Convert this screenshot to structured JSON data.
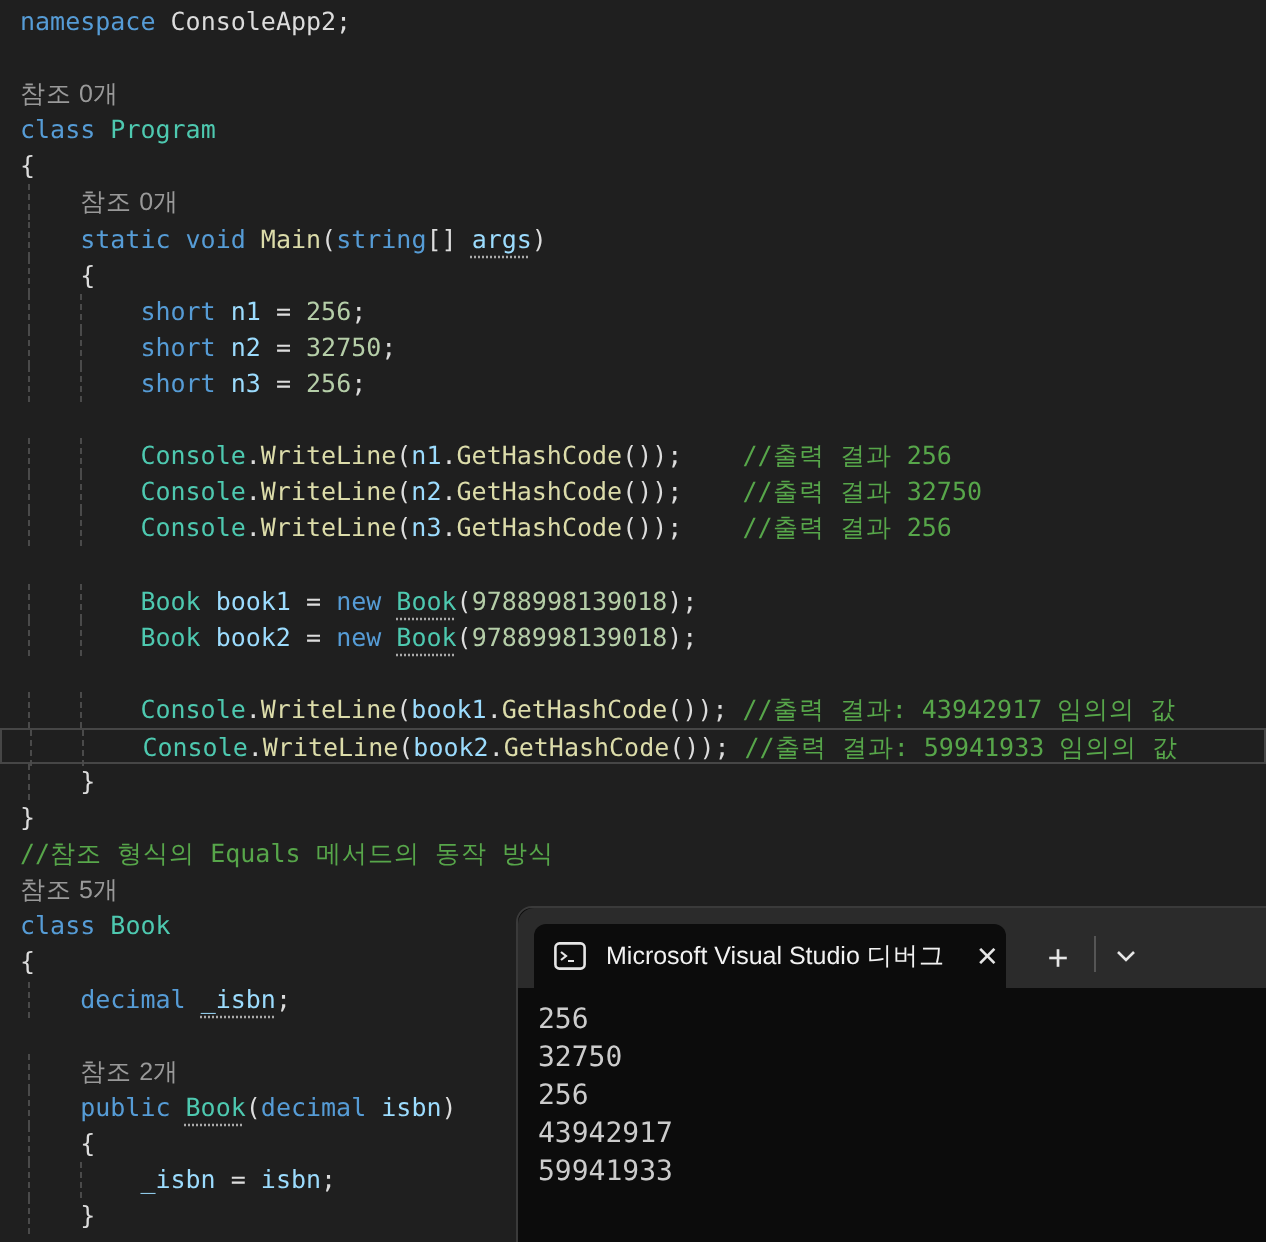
{
  "editor": {
    "lines": [
      {
        "kind": "code",
        "tokens": [
          {
            "kind": "keyword",
            "text": "namespace "
          },
          {
            "kind": "plain",
            "text": "ConsoleApp2;"
          }
        ]
      },
      {
        "kind": "blank"
      },
      {
        "kind": "lens",
        "tokens": [
          {
            "kind": "lens",
            "text": "참조 0개"
          }
        ]
      },
      {
        "kind": "code",
        "tokens": [
          {
            "kind": "keyword",
            "text": "class "
          },
          {
            "kind": "type",
            "text": "Program"
          }
        ]
      },
      {
        "kind": "code",
        "tokens": [
          {
            "kind": "plain",
            "text": "{"
          }
        ]
      },
      {
        "kind": "lens",
        "tokens": [
          {
            "kind": "lens",
            "text": "    참조 0개"
          }
        ]
      },
      {
        "kind": "code",
        "tokens": [
          {
            "kind": "keyword",
            "text": "    static void "
          },
          {
            "kind": "method",
            "text": "Main"
          },
          {
            "kind": "plain",
            "text": "("
          },
          {
            "kind": "keyword",
            "text": "string"
          },
          {
            "kind": "plain",
            "text": "[] "
          },
          {
            "kind": "variable",
            "text": "args",
            "hint": true
          },
          {
            "kind": "plain",
            "text": ")"
          }
        ]
      },
      {
        "kind": "code",
        "tokens": [
          {
            "kind": "plain",
            "text": "    {"
          }
        ]
      },
      {
        "kind": "code",
        "tokens": [
          {
            "kind": "keyword",
            "text": "        short "
          },
          {
            "kind": "variable",
            "text": "n1"
          },
          {
            "kind": "plain",
            "text": " = "
          },
          {
            "kind": "number",
            "text": "256"
          },
          {
            "kind": "plain",
            "text": ";"
          }
        ]
      },
      {
        "kind": "code",
        "tokens": [
          {
            "kind": "keyword",
            "text": "        short "
          },
          {
            "kind": "variable",
            "text": "n2"
          },
          {
            "kind": "plain",
            "text": " = "
          },
          {
            "kind": "number",
            "text": "32750"
          },
          {
            "kind": "plain",
            "text": ";"
          }
        ]
      },
      {
        "kind": "code",
        "tokens": [
          {
            "kind": "keyword",
            "text": "        short "
          },
          {
            "kind": "variable",
            "text": "n3"
          },
          {
            "kind": "plain",
            "text": " = "
          },
          {
            "kind": "number",
            "text": "256"
          },
          {
            "kind": "plain",
            "text": ";"
          }
        ]
      },
      {
        "kind": "blank"
      },
      {
        "kind": "code",
        "tokens": [
          {
            "kind": "type",
            "text": "        Console"
          },
          {
            "kind": "plain",
            "text": "."
          },
          {
            "kind": "method",
            "text": "WriteLine"
          },
          {
            "kind": "plain",
            "text": "("
          },
          {
            "kind": "variable",
            "text": "n1"
          },
          {
            "kind": "plain",
            "text": "."
          },
          {
            "kind": "method",
            "text": "GetHashCode"
          },
          {
            "kind": "plain",
            "text": "());    "
          },
          {
            "kind": "comment",
            "text": "//출력 결과 256"
          }
        ]
      },
      {
        "kind": "code",
        "tokens": [
          {
            "kind": "type",
            "text": "        Console"
          },
          {
            "kind": "plain",
            "text": "."
          },
          {
            "kind": "method",
            "text": "WriteLine"
          },
          {
            "kind": "plain",
            "text": "("
          },
          {
            "kind": "variable",
            "text": "n2"
          },
          {
            "kind": "plain",
            "text": "."
          },
          {
            "kind": "method",
            "text": "GetHashCode"
          },
          {
            "kind": "plain",
            "text": "());    "
          },
          {
            "kind": "comment",
            "text": "//출력 결과 32750"
          }
        ]
      },
      {
        "kind": "code",
        "tokens": [
          {
            "kind": "type",
            "text": "        Console"
          },
          {
            "kind": "plain",
            "text": "."
          },
          {
            "kind": "method",
            "text": "WriteLine"
          },
          {
            "kind": "plain",
            "text": "("
          },
          {
            "kind": "variable",
            "text": "n3"
          },
          {
            "kind": "plain",
            "text": "."
          },
          {
            "kind": "method",
            "text": "GetHashCode"
          },
          {
            "kind": "plain",
            "text": "());    "
          },
          {
            "kind": "comment",
            "text": "//출력 결과 256"
          }
        ]
      },
      {
        "kind": "blank"
      },
      {
        "kind": "code",
        "tokens": [
          {
            "kind": "type",
            "text": "        Book "
          },
          {
            "kind": "variable",
            "text": "book1"
          },
          {
            "kind": "plain",
            "text": " = "
          },
          {
            "kind": "keyword",
            "text": "new "
          },
          {
            "kind": "type",
            "text": "Book",
            "hint": true
          },
          {
            "kind": "plain",
            "text": "("
          },
          {
            "kind": "number",
            "text": "9788998139018"
          },
          {
            "kind": "plain",
            "text": ");"
          }
        ]
      },
      {
        "kind": "code",
        "tokens": [
          {
            "kind": "type",
            "text": "        Book "
          },
          {
            "kind": "variable",
            "text": "book2"
          },
          {
            "kind": "plain",
            "text": " = "
          },
          {
            "kind": "keyword",
            "text": "new "
          },
          {
            "kind": "type",
            "text": "Book",
            "hint": true
          },
          {
            "kind": "plain",
            "text": "("
          },
          {
            "kind": "number",
            "text": "9788998139018"
          },
          {
            "kind": "plain",
            "text": ");"
          }
        ]
      },
      {
        "kind": "blank"
      },
      {
        "kind": "code",
        "tokens": [
          {
            "kind": "type",
            "text": "        Console"
          },
          {
            "kind": "plain",
            "text": "."
          },
          {
            "kind": "method",
            "text": "WriteLine"
          },
          {
            "kind": "plain",
            "text": "("
          },
          {
            "kind": "variable",
            "text": "book1"
          },
          {
            "kind": "plain",
            "text": "."
          },
          {
            "kind": "method",
            "text": "GetHashCode"
          },
          {
            "kind": "plain",
            "text": "()); "
          },
          {
            "kind": "comment",
            "text": "//출력 결과: 43942917 임의의 값"
          }
        ]
      },
      {
        "kind": "code",
        "current": true,
        "tokens": [
          {
            "kind": "type",
            "text": "        Console"
          },
          {
            "kind": "plain",
            "text": "."
          },
          {
            "kind": "method",
            "text": "WriteLine"
          },
          {
            "kind": "plain",
            "text": "("
          },
          {
            "kind": "variable",
            "text": "book2"
          },
          {
            "kind": "plain",
            "text": "."
          },
          {
            "kind": "method",
            "text": "GetHashCode"
          },
          {
            "kind": "plain",
            "text": "()); "
          },
          {
            "kind": "comment",
            "text": "//출력 결과: 59941933 임의의 값"
          }
        ]
      },
      {
        "kind": "code",
        "tokens": [
          {
            "kind": "plain",
            "text": "    }"
          }
        ]
      },
      {
        "kind": "code",
        "tokens": [
          {
            "kind": "plain",
            "text": "}"
          }
        ]
      },
      {
        "kind": "code",
        "tokens": [
          {
            "kind": "comment",
            "text": "//참조 형식의 Equals 메서드의 동작 방식"
          }
        ]
      },
      {
        "kind": "lens",
        "tokens": [
          {
            "kind": "lens",
            "text": "참조 5개"
          }
        ]
      },
      {
        "kind": "code",
        "tokens": [
          {
            "kind": "keyword",
            "text": "class "
          },
          {
            "kind": "type",
            "text": "Book"
          }
        ]
      },
      {
        "kind": "code",
        "tokens": [
          {
            "kind": "plain",
            "text": "{"
          }
        ]
      },
      {
        "kind": "code",
        "tokens": [
          {
            "kind": "keyword",
            "text": "    decimal "
          },
          {
            "kind": "variable",
            "text": "_isbn",
            "hint": true
          },
          {
            "kind": "plain",
            "text": ";"
          }
        ]
      },
      {
        "kind": "blank"
      },
      {
        "kind": "lens",
        "tokens": [
          {
            "kind": "lens",
            "text": "    참조 2개"
          }
        ]
      },
      {
        "kind": "code",
        "tokens": [
          {
            "kind": "keyword",
            "text": "    public "
          },
          {
            "kind": "type",
            "text": "Book",
            "hint": true
          },
          {
            "kind": "plain",
            "text": "("
          },
          {
            "kind": "keyword",
            "text": "decimal "
          },
          {
            "kind": "variable",
            "text": "isbn"
          },
          {
            "kind": "plain",
            "text": ")"
          }
        ]
      },
      {
        "kind": "code",
        "tokens": [
          {
            "kind": "plain",
            "text": "    {"
          }
        ]
      },
      {
        "kind": "code",
        "tokens": [
          {
            "kind": "variable",
            "text": "        _isbn"
          },
          {
            "kind": "plain",
            "text": " = "
          },
          {
            "kind": "variable",
            "text": "isbn"
          },
          {
            "kind": "plain",
            "text": ";"
          }
        ]
      },
      {
        "kind": "code",
        "tokens": [
          {
            "kind": "plain",
            "text": "    }"
          }
        ]
      }
    ]
  },
  "terminal": {
    "tab": {
      "title": "Microsoft Visual Studio 디버그",
      "close": "×"
    },
    "new_tab": "+",
    "output": [
      "256",
      "32750",
      "256",
      "43942917",
      "59941933"
    ]
  }
}
